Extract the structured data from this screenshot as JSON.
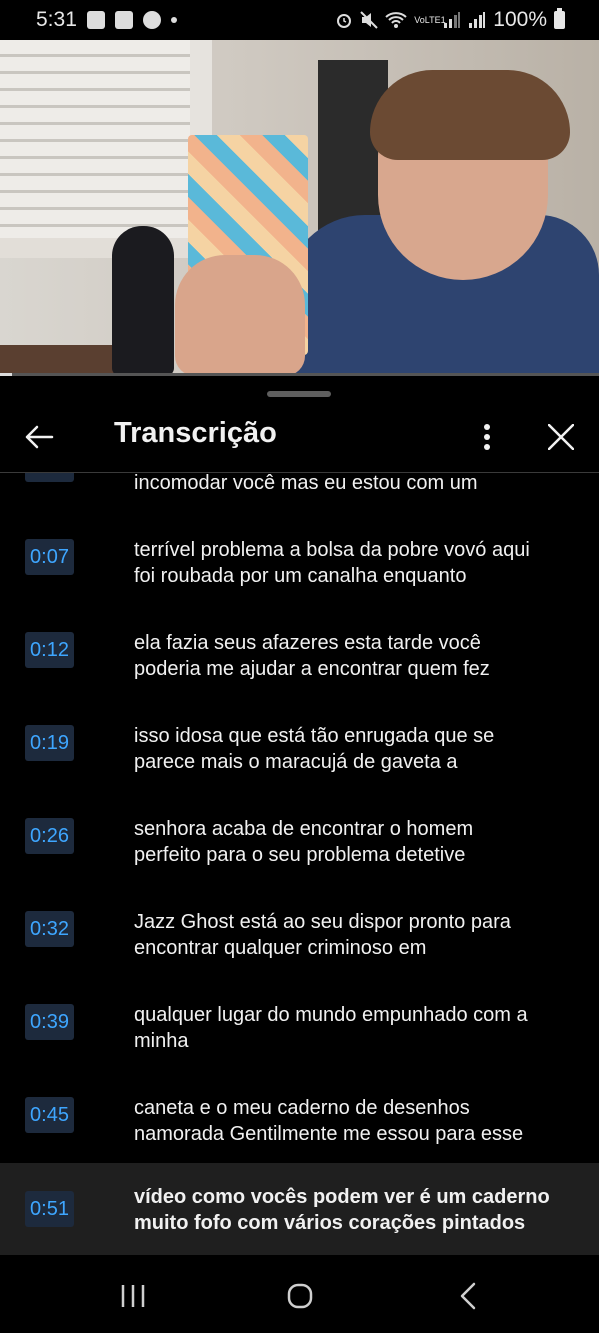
{
  "status_bar": {
    "time": "5:31",
    "battery": "100%",
    "network_label": "VoLTE1",
    "icons": [
      "gallery-icon",
      "shield-icon",
      "cloud-icon",
      "alarm-icon",
      "mute-icon",
      "wifi-icon",
      "signal-icon",
      "signal-icon",
      "battery-icon"
    ]
  },
  "video": {
    "progress_fraction": 0.02
  },
  "panel": {
    "title": "Transcrição",
    "partial_line": "incomodar você mas eu estou com um",
    "segments": [
      {
        "time": "0:07",
        "line1": "terrível problema a bolsa da pobre vovó aqui",
        "line2": "foi roubada por um canalha enquanto"
      },
      {
        "time": "0:12",
        "line1": "ela fazia seus afazeres esta tarde você",
        "line2": "poderia me ajudar a encontrar quem fez"
      },
      {
        "time": "0:19",
        "line1": "isso idosa que está tão enrugada que se",
        "line2": "parece mais o maracujá de gaveta a"
      },
      {
        "time": "0:26",
        "line1": "senhora acaba de encontrar o homem",
        "line2": "perfeito para o seu problema detetive"
      },
      {
        "time": "0:32",
        "line1": "Jazz Ghost está ao seu dispor pronto para",
        "line2": "encontrar qualquer criminoso em"
      },
      {
        "time": "0:39",
        "line1": "qualquer lugar do mundo empunhado com a",
        "line2": "minha"
      },
      {
        "time": "0:45",
        "line1": "caneta e o meu caderno de desenhos",
        "line2": "namorada Gentilmente me essou para esse"
      },
      {
        "time": "0:51",
        "line1": "vídeo como vocês podem ver é um caderno",
        "line2": "muito fofo com vários corações pintados",
        "active": true
      }
    ]
  },
  "colors": {
    "timestamp_text": "#3ea6ff",
    "timestamp_bg": "#1d2a3d",
    "active_row_bg": "#1f1f1f"
  }
}
